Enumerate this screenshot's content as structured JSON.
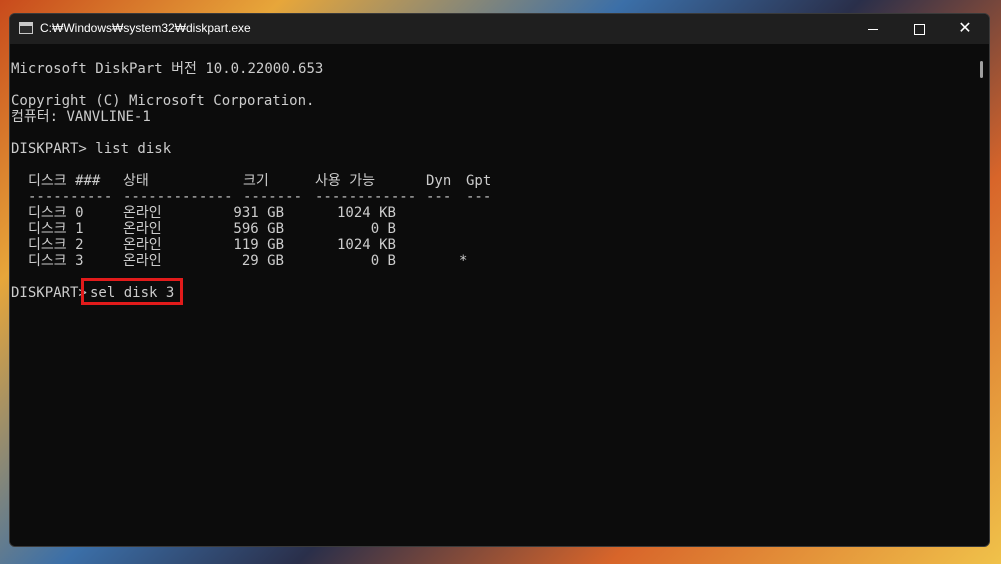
{
  "window": {
    "title": "C:₩Windows₩system32₩diskpart.exe",
    "controls": {
      "minimize": "minimize",
      "maximize": "maximize",
      "close": "✕"
    }
  },
  "console": {
    "header_line": "Microsoft DiskPart 버전 10.0.22000.653",
    "copyright": "Copyright (C) Microsoft Corporation.",
    "computer": "컴퓨터: VANVLINE-1",
    "command1": "DISKPART> list disk",
    "table": {
      "headers": [
        "디스크 ###",
        "상태",
        "크기",
        "사용 가능",
        "Dyn",
        "Gpt"
      ],
      "separators": [
        "----------",
        "-------------",
        "-------",
        "------------",
        "---",
        "---"
      ],
      "rows": [
        [
          "디스크 0",
          "온라인",
          "931 GB",
          "1024 KB",
          "",
          ""
        ],
        [
          "디스크 1",
          "온라인",
          "596 GB",
          "0 B",
          "",
          ""
        ],
        [
          "디스크 2",
          "온라인",
          "119 GB",
          "1024 KB",
          "",
          ""
        ],
        [
          "디스크 3",
          "온라인",
          "29 GB",
          "0 B",
          "",
          "*"
        ]
      ]
    },
    "prompt2": "DISKPART>",
    "command2": "sel disk 3"
  },
  "colors": {
    "console_bg": "#0c0c0c",
    "console_text": "#cccccc",
    "highlight": "#e21b1b"
  }
}
